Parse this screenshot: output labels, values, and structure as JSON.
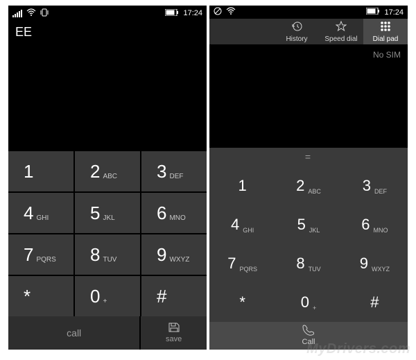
{
  "time": "17:24",
  "left": {
    "carrier": "EE",
    "keys": [
      {
        "d": "1",
        "l": ""
      },
      {
        "d": "2",
        "l": "ABC"
      },
      {
        "d": "3",
        "l": "DEF"
      },
      {
        "d": "4",
        "l": "GHI"
      },
      {
        "d": "5",
        "l": "JKL"
      },
      {
        "d": "6",
        "l": "MNO"
      },
      {
        "d": "7",
        "l": "PQRS"
      },
      {
        "d": "8",
        "l": "TUV"
      },
      {
        "d": "9",
        "l": "WXYZ"
      },
      {
        "d": "*",
        "l": ""
      },
      {
        "d": "0",
        "l": "+"
      },
      {
        "d": "#",
        "l": ""
      }
    ],
    "call_label": "call",
    "save_label": "save"
  },
  "right": {
    "tabs": [
      {
        "id": "history",
        "label": "History"
      },
      {
        "id": "speeddial",
        "label": "Speed dial"
      },
      {
        "id": "dialpad",
        "label": "Dial pad",
        "active": true
      }
    ],
    "nosim": "No SIM",
    "display": "=",
    "keys": [
      {
        "d": "1",
        "l": ""
      },
      {
        "d": "2",
        "l": "ABC"
      },
      {
        "d": "3",
        "l": "DEF"
      },
      {
        "d": "4",
        "l": "GHI"
      },
      {
        "d": "5",
        "l": "JKL"
      },
      {
        "d": "6",
        "l": "MNO"
      },
      {
        "d": "7",
        "l": "PQRS"
      },
      {
        "d": "8",
        "l": "TUV"
      },
      {
        "d": "9",
        "l": "WXYZ"
      },
      {
        "d": "*",
        "l": ""
      },
      {
        "d": "0",
        "l": "+"
      },
      {
        "d": "#",
        "l": ""
      }
    ],
    "call_label": "Call"
  },
  "watermark": "MyDrivers.com"
}
